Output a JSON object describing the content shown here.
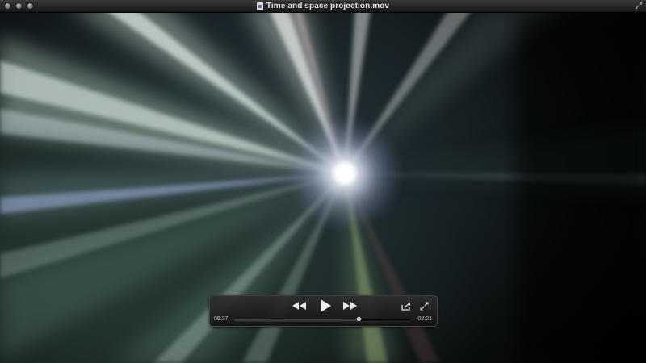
{
  "window": {
    "title": "Time and space projection.mov"
  },
  "controller": {
    "elapsed": "05:37",
    "remaining": "-02:21",
    "progress": 0.705
  }
}
